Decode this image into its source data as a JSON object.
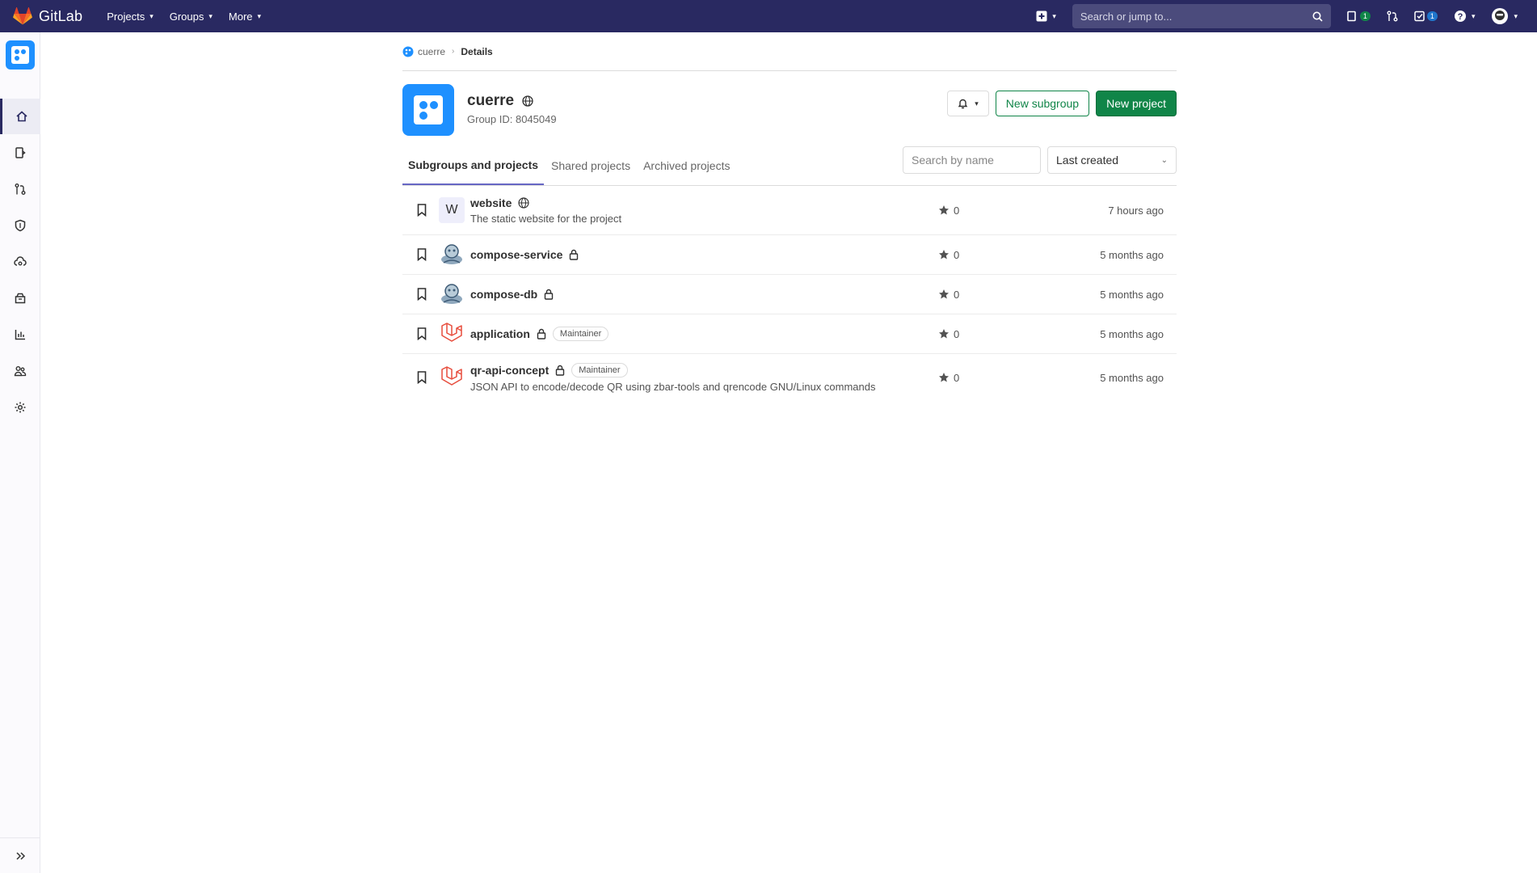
{
  "topbar": {
    "brand": "GitLab",
    "menus": [
      {
        "label": "Projects"
      },
      {
        "label": "Groups"
      },
      {
        "label": "More"
      }
    ],
    "search_placeholder": "Search or jump to...",
    "issues_count": "1",
    "todos_count": "1",
    "brand_color": "#292961"
  },
  "sidebar": {
    "items": [
      {
        "name": "group-overview",
        "icon": "home-icon"
      },
      {
        "name": "issues",
        "icon": "issues-icon"
      },
      {
        "name": "merge-requests",
        "icon": "merge-request-icon"
      },
      {
        "name": "security",
        "icon": "shield-icon"
      },
      {
        "name": "deployments",
        "icon": "cloud-gear-icon"
      },
      {
        "name": "packages",
        "icon": "package-icon"
      },
      {
        "name": "analytics",
        "icon": "chart-icon"
      },
      {
        "name": "members",
        "icon": "users-icon"
      },
      {
        "name": "settings",
        "icon": "gear-icon"
      }
    ]
  },
  "breadcrumb": {
    "group": "cuerre",
    "current": "Details"
  },
  "group": {
    "name": "cuerre",
    "id_text": "Group ID: 8045049",
    "avatar_color": "#1e90ff"
  },
  "actions": {
    "new_subgroup": "New subgroup",
    "new_project": "New project"
  },
  "tabs": [
    {
      "label": "Subgroups and projects",
      "active": true
    },
    {
      "label": "Shared projects",
      "active": false
    },
    {
      "label": "Archived projects",
      "active": false
    }
  ],
  "filter": {
    "search_placeholder": "Search by name",
    "sort_value": "Last created"
  },
  "projects": [
    {
      "name": "website",
      "avatar_letter": "W",
      "visibility": "public",
      "role": "",
      "description": "The static website for the project",
      "stars": "0",
      "updated": "7 hours ago"
    },
    {
      "name": "compose-service",
      "avatar_letter": "",
      "visibility": "private",
      "role": "",
      "description": "",
      "stars": "0",
      "updated": "5 months ago"
    },
    {
      "name": "compose-db",
      "avatar_letter": "",
      "visibility": "private",
      "role": "",
      "description": "",
      "stars": "0",
      "updated": "5 months ago"
    },
    {
      "name": "application",
      "avatar_letter": "",
      "visibility": "private",
      "role": "Maintainer",
      "description": "",
      "stars": "0",
      "updated": "5 months ago"
    },
    {
      "name": "qr-api-concept",
      "avatar_letter": "",
      "visibility": "private",
      "role": "Maintainer",
      "description": "JSON API to encode/decode QR using zbar-tools and qrencode GNU/Linux commands",
      "stars": "0",
      "updated": "5 months ago"
    }
  ]
}
